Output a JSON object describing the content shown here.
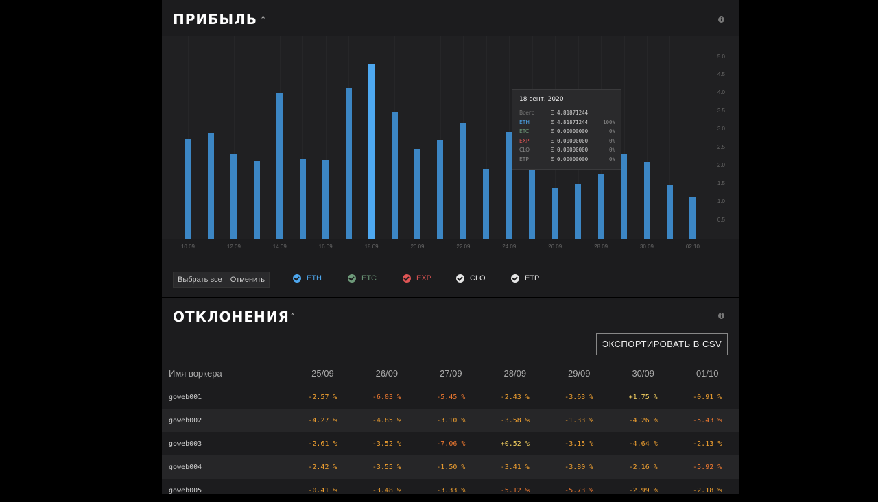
{
  "profit": {
    "title": "ПРИБЫЛЬ",
    "chart_data": {
      "type": "bar",
      "categories": [
        "10.09",
        "11.09",
        "12.09",
        "13.09",
        "14.09",
        "15.09",
        "16.09",
        "17.09",
        "18.09",
        "19.09",
        "20.09",
        "21.09",
        "22.09",
        "23.09",
        "24.09",
        "25.09",
        "26.09",
        "27.09",
        "28.09",
        "29.09",
        "30.09",
        "01.10",
        "02.10"
      ],
      "series": [
        {
          "name": "ETH",
          "values": [
            2.77,
            2.92,
            2.32,
            2.13,
            4.01,
            2.19,
            2.16,
            4.15,
            4.81871244,
            3.49,
            2.48,
            2.73,
            3.18,
            1.92,
            2.93,
            1.92,
            1.4,
            1.52,
            1.77,
            2.32,
            2.12,
            1.47,
            1.16
          ]
        }
      ],
      "x_tick_labels": [
        "10.09",
        "12.09",
        "14.09",
        "16.09",
        "18.09",
        "20.09",
        "22.09",
        "24.09",
        "26.09",
        "28.09",
        "30.09",
        "02.10"
      ],
      "y_tick_labels": [
        "0.5",
        "1.0",
        "1.5",
        "2.0",
        "2.5",
        "3.0",
        "3.5",
        "4.0",
        "4.5",
        "5.0"
      ],
      "ylim": [
        0,
        5.2
      ],
      "highlight_index": 8
    },
    "tooltip": {
      "date": "18 сент. 2020",
      "rows": [
        {
          "label": "Всего",
          "value": "Ξ 4.81871244",
          "pct": "",
          "color": "#777777"
        },
        {
          "label": "ETH",
          "value": "Ξ 4.81871244",
          "pct": "100%",
          "color": "#4ea8f0"
        },
        {
          "label": "ETC",
          "value": "Ξ 0.00000000",
          "pct": "0%",
          "color": "#6e9a7a"
        },
        {
          "label": "EXP",
          "value": "Ξ 0.00000000",
          "pct": "0%",
          "color": "#e05555"
        },
        {
          "label": "CLO",
          "value": "Ξ 0.00000000",
          "pct": "0%",
          "color": "#888888"
        },
        {
          "label": "ETP",
          "value": "Ξ 0.00000000",
          "pct": "0%",
          "color": "#888888"
        }
      ]
    },
    "select_all": "Выбрать все",
    "cancel": "Отменить",
    "legend": [
      {
        "label": "ETH",
        "color": "#4ea8f0"
      },
      {
        "label": "ETC",
        "color": "#6e9a7a"
      },
      {
        "label": "EXP",
        "color": "#e05555"
      },
      {
        "label": "CLO",
        "color": "#e6e6e6"
      },
      {
        "label": "ETP",
        "color": "#e6e6e6"
      }
    ]
  },
  "deviations": {
    "title": "ОТКЛОНЕНИЯ",
    "export_label": "ЭКСПОРТИРОВАТЬ В CSV",
    "headers": [
      "Имя воркера",
      "25/09",
      "26/09",
      "27/09",
      "28/09",
      "29/09",
      "30/09",
      "01/10"
    ],
    "rows": [
      {
        "name": "goweb001",
        "values": [
          "-2.57 %",
          "-6.03 %",
          "-5.45 %",
          "-2.43 %",
          "-3.63 %",
          "+1.75 %",
          "-0.91 %"
        ]
      },
      {
        "name": "goweb002",
        "values": [
          "-4.27 %",
          "-4.85 %",
          "-3.10 %",
          "-3.58 %",
          "-1.33 %",
          "-4.26 %",
          "-5.43 %"
        ]
      },
      {
        "name": "goweb003",
        "values": [
          "-2.61 %",
          "-3.52 %",
          "-7.06 %",
          "+0.52 %",
          "-3.15 %",
          "-4.64 %",
          "-2.13 %"
        ]
      },
      {
        "name": "goweb004",
        "values": [
          "-2.42 %",
          "-3.55 %",
          "-1.50 %",
          "-3.41 %",
          "-3.80 %",
          "-2.16 %",
          "-5.92 %"
        ]
      },
      {
        "name": "goweb005",
        "values": [
          "-0.41 %",
          "-3.48 %",
          "-3.33 %",
          "-5.12 %",
          "-5.73 %",
          "-2.99 %",
          "-2.18 %"
        ]
      }
    ],
    "colors": {
      "negative": "#f0a030",
      "strong_negative": "#f07a30",
      "positive": "#f5d060"
    }
  }
}
